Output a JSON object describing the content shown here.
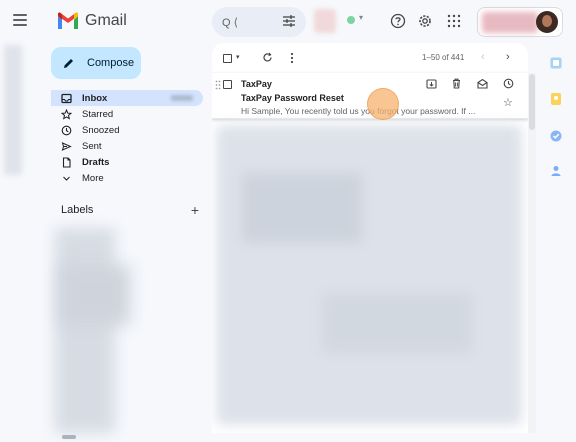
{
  "app": {
    "name": "Gmail"
  },
  "header": {
    "search_text": "Q ⟨",
    "icons": [
      "menu-icon",
      "search-icon",
      "filter-icon",
      "help-icon",
      "settings-icon",
      "apps-icon"
    ]
  },
  "sidebar": {
    "compose_label": "Compose",
    "items": [
      {
        "label": "Inbox",
        "icon": "inbox-icon"
      },
      {
        "label": "Starred",
        "icon": "star-icon"
      },
      {
        "label": "Snoozed",
        "icon": "clock-icon"
      },
      {
        "label": "Sent",
        "icon": "send-icon"
      },
      {
        "label": "Drafts",
        "icon": "draft-icon"
      },
      {
        "label": "More",
        "icon": "chevron-down-icon"
      }
    ],
    "labels_title": "Labels",
    "labels_add": "+"
  },
  "toolbar": {
    "pager": "1–50 of 441",
    "prev": "‹",
    "next": "›"
  },
  "email": {
    "sender": "TaxPay",
    "subject": "TaxPay Password Reset",
    "snippet": "Hi Sample, You recently told us you forgot your password. If ..."
  },
  "colors": {
    "compose_bg": "#c2e7ff",
    "active_nav_bg": "#d3e3fd",
    "page_bg": "#f6f8fc",
    "click_marker": "#f7b26e"
  }
}
